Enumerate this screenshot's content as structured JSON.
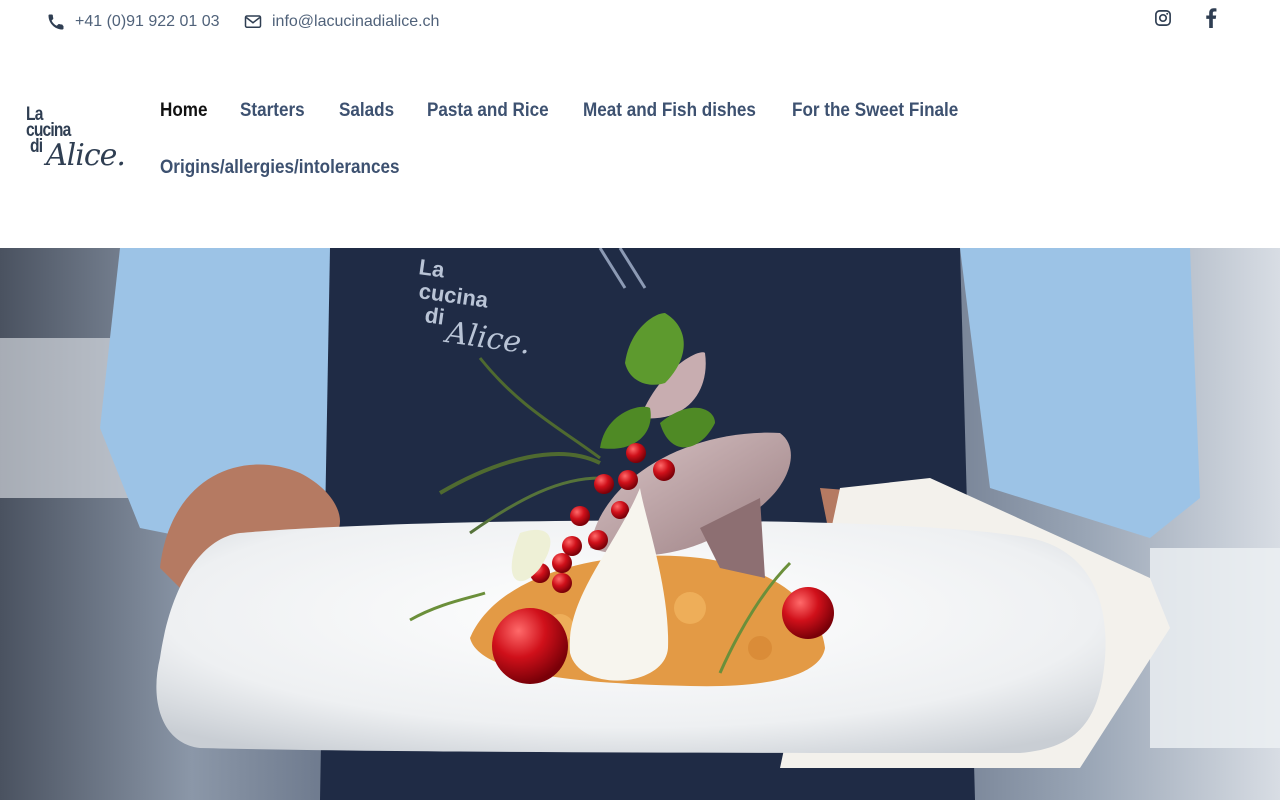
{
  "contact": {
    "phone": "+41 (0)91 922 01 03",
    "email": "info@lacucinadialice.ch",
    "phone_icon": "phone-icon",
    "email_icon": "envelope-icon"
  },
  "social": [
    {
      "name": "instagram-icon"
    },
    {
      "name": "facebook-icon"
    }
  ],
  "logo": {
    "line1": "La",
    "line2": "cucina",
    "line3": "di",
    "line4": "Alice."
  },
  "nav": {
    "items": [
      {
        "label": "Home",
        "active": true
      },
      {
        "label": "Starters"
      },
      {
        "label": "Salads"
      },
      {
        "label": "Pasta and Rice"
      },
      {
        "label": "Meat and Fish dishes"
      },
      {
        "label": "For the Sweet Finale"
      },
      {
        "label": "Origins/allergies/intolerances"
      }
    ]
  },
  "hero": {
    "apron_logo_line1": "La",
    "apron_logo_line2": "cucina",
    "apron_logo_line3": "di",
    "apron_logo_line4": "Alice."
  },
  "colors": {
    "nav_text": "#3d5170",
    "nav_active": "#111111",
    "contact_text": "#50627a",
    "apron": "#1f2b45",
    "shirt": "#9cc3e6"
  }
}
